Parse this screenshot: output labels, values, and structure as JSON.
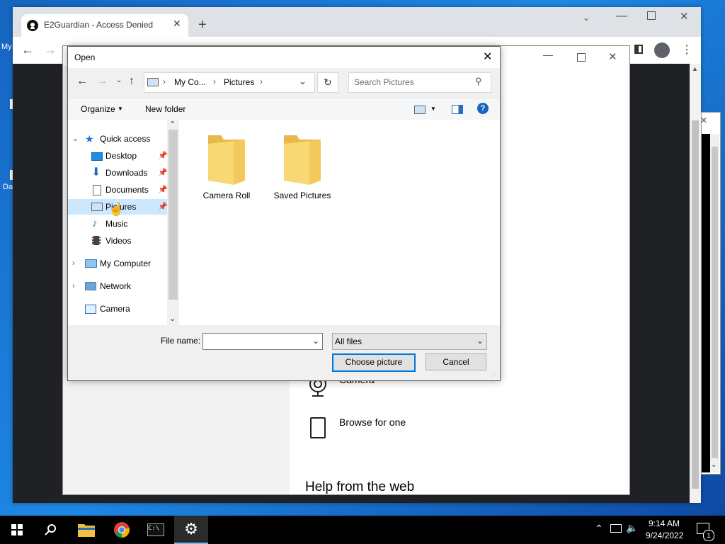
{
  "desktop": {
    "frag_top": "My",
    "frag_bottom": "Da"
  },
  "browser": {
    "tab_title": "E2Guardian - Access Denied",
    "new_tab": "+"
  },
  "settings_bg": {
    "camera_label": "Camera",
    "browse_label": "Browse for one",
    "help_heading": "Help from the web"
  },
  "dialog": {
    "title": "Open",
    "breadcrumb": [
      "My Co...",
      "Pictures"
    ],
    "search_placeholder": "Search Pictures",
    "toolbar": {
      "organize": "Organize",
      "new_folder": "New folder"
    },
    "nav": {
      "quick_access": "Quick access",
      "items": [
        {
          "label": "Desktop",
          "icon": "desktop-icon",
          "pinned": true
        },
        {
          "label": "Downloads",
          "icon": "downloads-icon",
          "pinned": true
        },
        {
          "label": "Documents",
          "icon": "documents-icon",
          "pinned": true
        },
        {
          "label": "Pictures",
          "icon": "pictures-icon",
          "pinned": true,
          "selected": true
        },
        {
          "label": "Music",
          "icon": "music-icon",
          "pinned": false
        },
        {
          "label": "Videos",
          "icon": "videos-icon",
          "pinned": false
        }
      ],
      "my_computer": "My Computer",
      "network": "Network",
      "camera": "Camera"
    },
    "folders": [
      {
        "label": "Camera Roll"
      },
      {
        "label": "Saved Pictures"
      }
    ],
    "file_name_label": "File name:",
    "file_name_value": "",
    "file_type": "All files",
    "choose_button": "Choose picture",
    "cancel_button": "Cancel"
  },
  "taskbar": {
    "time": "9:14 AM",
    "date": "9/24/2022",
    "notification_count": "1"
  },
  "colors": {
    "accent": "#0078d7",
    "selection": "#cce8ff",
    "folder": "#f8d775"
  }
}
